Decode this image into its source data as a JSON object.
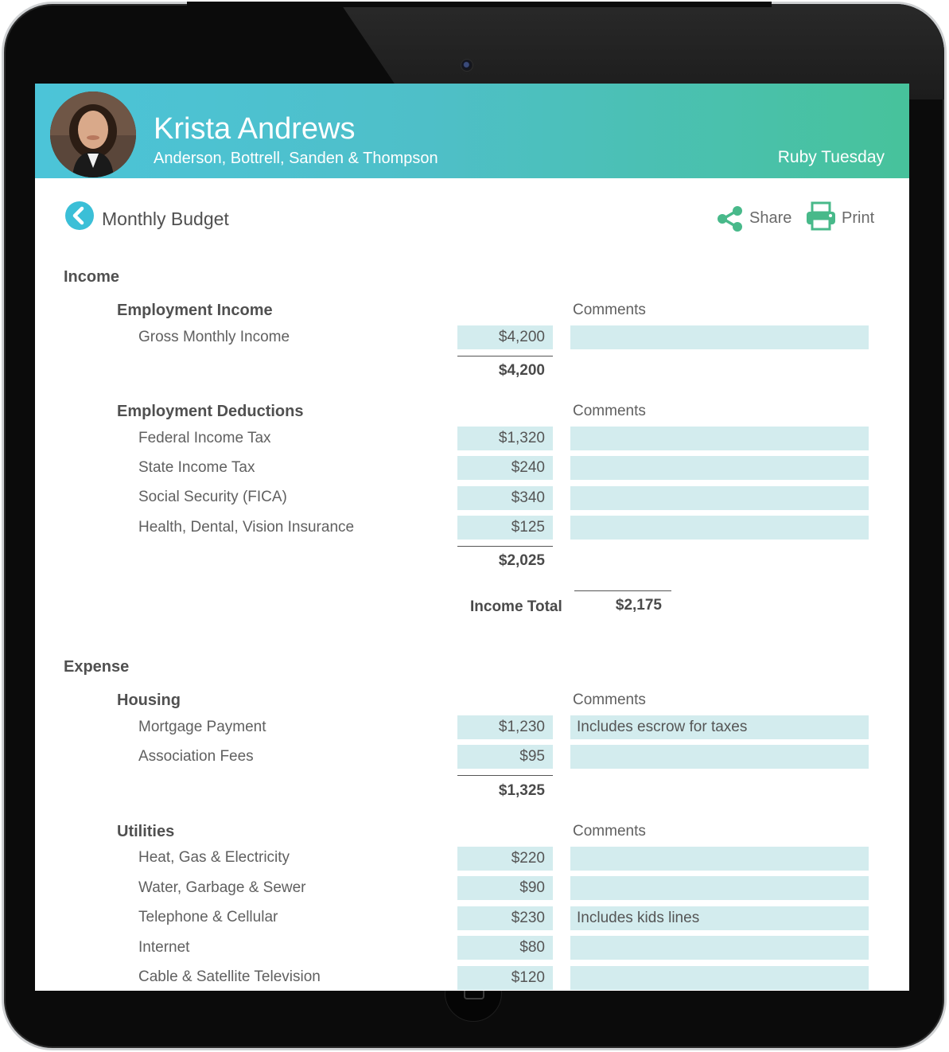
{
  "header": {
    "client_name": "Krista Andrews",
    "firm_name": "Anderson, Bottrell, Sanden & Thompson",
    "advisor_name": "Ruby Tuesday"
  },
  "toolbar": {
    "page_title": "Monthly Budget",
    "share_label": "Share",
    "print_label": "Print"
  },
  "colors": {
    "header_start": "#4cc4d8",
    "header_end": "#47c29b",
    "accent": "#3bbfd7",
    "action_icon": "#48b98a",
    "field_bg": "#d3ecee"
  },
  "income": {
    "title": "Income",
    "employment_income": {
      "title": "Employment Income",
      "comments_label": "Comments",
      "items": [
        {
          "label": "Gross Monthly Income",
          "amount": "$4,200",
          "comment": ""
        }
      ],
      "subtotal": "$4,200"
    },
    "employment_deductions": {
      "title": "Employment Deductions",
      "comments_label": "Comments",
      "items": [
        {
          "label": "Federal Income Tax",
          "amount": "$1,320",
          "comment": ""
        },
        {
          "label": "State Income Tax",
          "amount": "$240",
          "comment": ""
        },
        {
          "label": "Social Security (FICA)",
          "amount": "$340",
          "comment": ""
        },
        {
          "label": "Health, Dental, Vision Insurance",
          "amount": "$125",
          "comment": ""
        }
      ],
      "subtotal": "$2,025"
    },
    "total_label": "Income Total",
    "total_value": "$2,175"
  },
  "expense": {
    "title": "Expense",
    "housing": {
      "title": "Housing",
      "comments_label": "Comments",
      "items": [
        {
          "label": "Mortgage Payment",
          "amount": "$1,230",
          "comment": "Includes escrow for taxes"
        },
        {
          "label": "Association Fees",
          "amount": "$95",
          "comment": ""
        }
      ],
      "subtotal": "$1,325"
    },
    "utilities": {
      "title": "Utilities",
      "comments_label": "Comments",
      "items": [
        {
          "label": "Heat, Gas & Electricity",
          "amount": "$220",
          "comment": ""
        },
        {
          "label": "Water, Garbage & Sewer",
          "amount": "$90",
          "comment": ""
        },
        {
          "label": "Telephone & Cellular",
          "amount": "$230",
          "comment": "Includes kids lines"
        },
        {
          "label": "Internet",
          "amount": "$80",
          "comment": ""
        },
        {
          "label": "Cable & Satellite Television",
          "amount": "$120",
          "comment": ""
        }
      ]
    }
  }
}
